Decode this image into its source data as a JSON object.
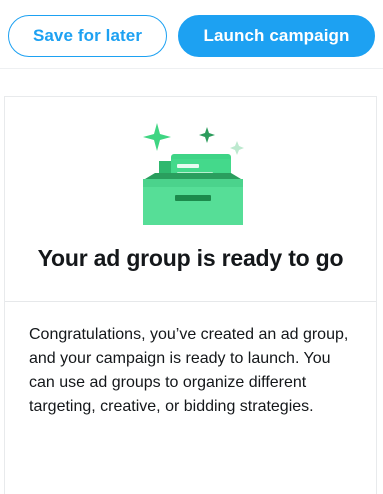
{
  "toolbar": {
    "save_label": "Save for later",
    "launch_label": "Launch campaign"
  },
  "card": {
    "headline": "Your ad group is ready to go",
    "description": "Congratulations, you’ve created an ad group, and your campaign is ready to launch. You can use ad groups to organize different targeting, creative, or bidding strategies.",
    "illustration_icon": "inbox-tray-sparkles-icon"
  },
  "colors": {
    "accent": "#1da1f2",
    "illustration_green": "#3fd582",
    "text": "#14171a"
  }
}
